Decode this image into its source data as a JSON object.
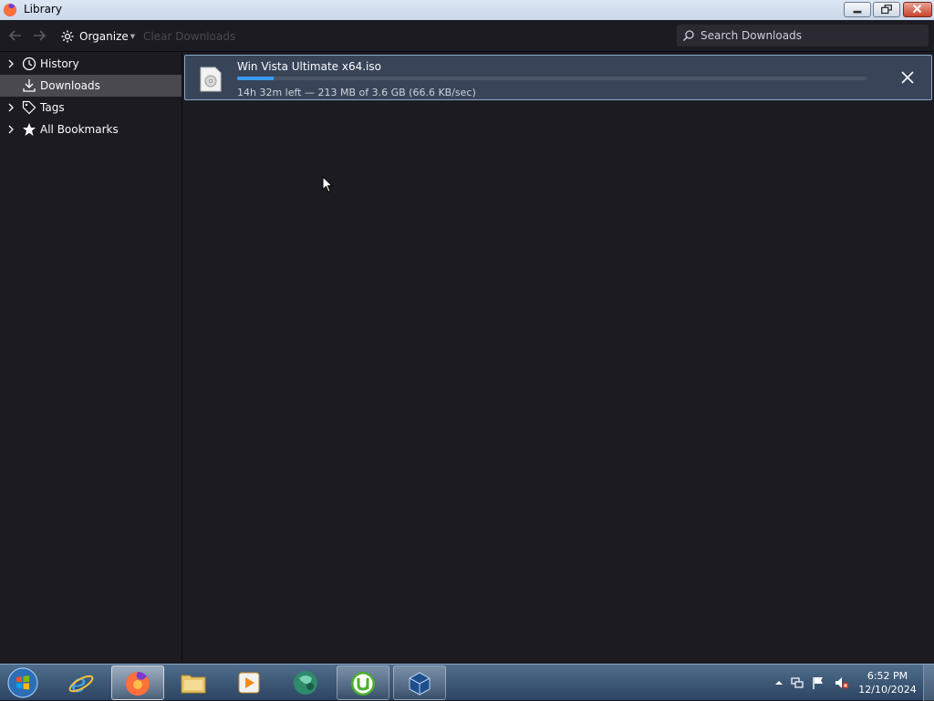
{
  "window": {
    "title": "Library"
  },
  "toolbar": {
    "organize_label": "Organize",
    "clear_downloads_label": "Clear Downloads",
    "search_placeholder": "Search Downloads"
  },
  "sidebar": {
    "items": [
      {
        "label": "History",
        "icon": "clock-icon"
      },
      {
        "label": "Downloads",
        "icon": "download-icon",
        "selected": true
      },
      {
        "label": "Tags",
        "icon": "tag-icon"
      },
      {
        "label": "All Bookmarks",
        "icon": "star-icon"
      }
    ]
  },
  "downloads": [
    {
      "filename": "Win Vista Ultimate x64.iso",
      "status": "14h 32m left — 213 MB of 3.6 GB (66.6 KB/sec)",
      "progress_percent": 5.8
    }
  ],
  "taskbar": {
    "apps": [
      "internet-explorer",
      "firefox",
      "file-explorer",
      "media-player",
      "browser-globe",
      "utorrent",
      "virtualbox"
    ],
    "clock_time": "6:52 PM",
    "clock_date": "12/10/2024"
  },
  "colors": {
    "accent": "#3a9cf4",
    "selected_row": "#4a4950",
    "download_row": "#384559"
  }
}
